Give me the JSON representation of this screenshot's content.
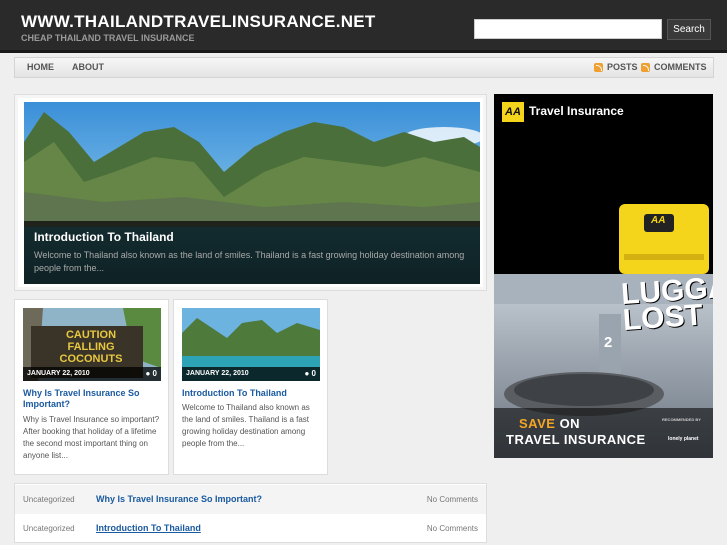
{
  "header": {
    "site_title": "WWW.THAILANDTRAVELINSURANCE.NET",
    "tagline": "CHEAP THAILAND TRAVEL INSURANCE",
    "search_button": "Search",
    "search_value": ""
  },
  "nav": {
    "items": [
      {
        "label": "HOME"
      },
      {
        "label": "ABOUT"
      }
    ],
    "posts_label": "POSTS",
    "comments_label": "COMMENTS"
  },
  "featured": {
    "title": "Introduction To Thailand",
    "excerpt": "Welcome to Thailand also known as the land of smiles. Thailand is a fast growing holiday destination among people from the..."
  },
  "cards": [
    {
      "date": "JANUARY 22, 2010",
      "comments": "0",
      "sign_text": [
        "CAUTION",
        "FALLING",
        "COCONUTS"
      ],
      "title": "Why Is Travel Insurance So Important?",
      "excerpt": "Why is Travel Insurance so important? After booking that holiday of a lifetime the second most important thing on anyone list..."
    },
    {
      "date": "JANUARY 22, 2010",
      "comments": "0",
      "title": "Introduction To Thailand",
      "excerpt": "Welcome to Thailand also known as the land of smiles. Thailand is a fast growing holiday destination among people from the..."
    }
  ],
  "post_list": [
    {
      "category": "Uncategorized",
      "title": "Why Is Travel Insurance So Important?",
      "comments": "No Comments"
    },
    {
      "category": "Uncategorized",
      "title": "Introduction To Thailand",
      "comments": "No Comments"
    }
  ],
  "ad": {
    "logo": "AA",
    "title": "Travel Insurance",
    "headline": "LUGGAGE LOST",
    "save_word": "SAVE",
    "save_rest": "ON",
    "save_line2": "TRAVEL INSURANCE",
    "recommended": "RECOMMENDED BY",
    "partner": "lonely planet",
    "gate_number": "2"
  },
  "colors": {
    "header_bg": "#2a2a2a",
    "link": "#1a5aa0",
    "ad_accent": "#f5d41c"
  }
}
